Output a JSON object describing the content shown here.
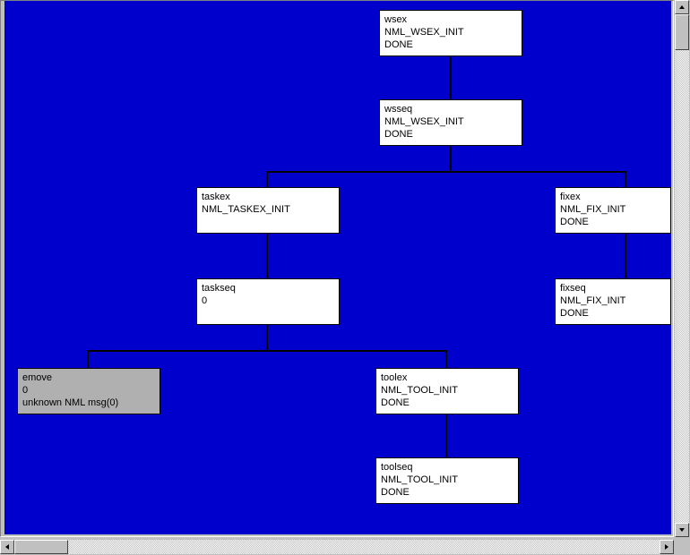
{
  "nodes": {
    "wsex": {
      "name": "wsex",
      "cmd": "NML_WSEX_INIT",
      "status": "DONE"
    },
    "wsseq": {
      "name": "wsseq",
      "cmd": "NML_WSEX_INIT",
      "status": "DONE"
    },
    "taskex": {
      "name": "taskex",
      "cmd": "NML_TASKEX_INIT",
      "status": ""
    },
    "fixex": {
      "name": "fixex",
      "cmd": "NML_FIX_INIT",
      "status": "DONE"
    },
    "taskseq": {
      "name": "taskseq",
      "cmd": "0",
      "status": ""
    },
    "fixseq": {
      "name": "fixseq",
      "cmd": "NML_FIX_INIT",
      "status": "DONE"
    },
    "emove": {
      "name": "emove",
      "cmd": "0",
      "status": "unknown NML msg(0)"
    },
    "toolex": {
      "name": "toolex",
      "cmd": "NML_TOOL_INIT",
      "status": "DONE"
    },
    "toolseq": {
      "name": "toolseq",
      "cmd": "NML_TOOL_INIT",
      "status": "DONE"
    }
  }
}
